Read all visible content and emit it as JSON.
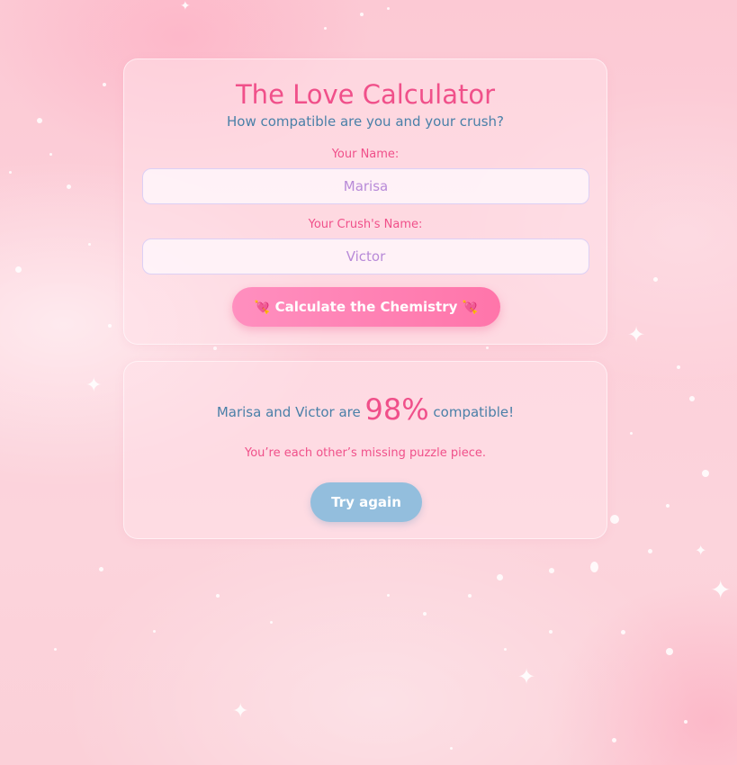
{
  "header": {
    "title": "The Love Calculator",
    "subtitle": "How compatible are you and your crush?"
  },
  "form": {
    "name_label": "Your Name:",
    "name_value": "Marisa",
    "crush_label": "Your Crush's Name:",
    "crush_value": "Victor",
    "calculate_label": "Calculate the Chemistry",
    "button_icon": "heart-arrow-icon"
  },
  "result": {
    "name_one": "Marisa",
    "name_two": "Victor",
    "connector": "and",
    "are_text": "are",
    "percentage": "98%",
    "suffix": "compatible!",
    "message": "You’re each other’s missing puzzle piece.",
    "try_again_label": "Try again"
  },
  "colors": {
    "accent_pink": "#f0508a",
    "text_blue": "#4a80a8",
    "button_pink": "#ff80b3",
    "button_blue": "#93bedd",
    "background": "#fcc9d4"
  }
}
